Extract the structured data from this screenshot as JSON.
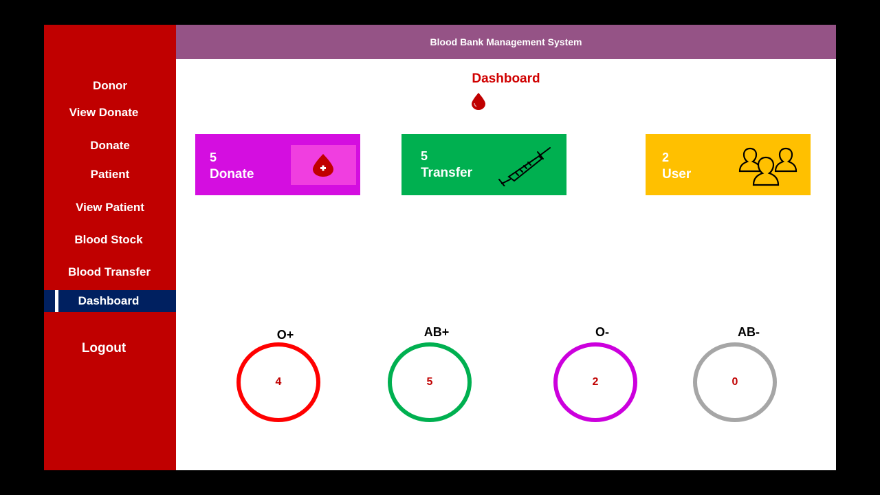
{
  "header": {
    "title": "Blood Bank Management System"
  },
  "sidebar": {
    "items": [
      {
        "label": "Donor"
      },
      {
        "label": "View Donate"
      },
      {
        "label": "Donate"
      },
      {
        "label": "Patient"
      },
      {
        "label": "View Patient"
      },
      {
        "label": "Blood Stock"
      },
      {
        "label": "Blood Transfer"
      },
      {
        "label": "Dashboard",
        "active": true
      },
      {
        "label": "Logout"
      }
    ]
  },
  "main": {
    "title": "Dashboard",
    "cards": [
      {
        "count": "5",
        "label": "Donate",
        "icon": "blood-drop-plus-icon",
        "color": "#d40ee0"
      },
      {
        "count": "5",
        "label": "Transfer",
        "icon": "syringe-icon",
        "color": "#00b050"
      },
      {
        "count": "2",
        "label": "User",
        "icon": "users-icon",
        "color": "#ffc000"
      }
    ],
    "blood_groups": [
      {
        "group": "O+",
        "count": "4",
        "color": "#ff0000"
      },
      {
        "group": "AB+",
        "count": "5",
        "color": "#00b050"
      },
      {
        "group": "O-",
        "count": "2",
        "color": "#cc00dd"
      },
      {
        "group": "AB-",
        "count": "0",
        "color": "#a6a6a6"
      }
    ]
  },
  "colors": {
    "sidebar": "#c00000",
    "header": "#955386",
    "active_item": "#002060"
  }
}
